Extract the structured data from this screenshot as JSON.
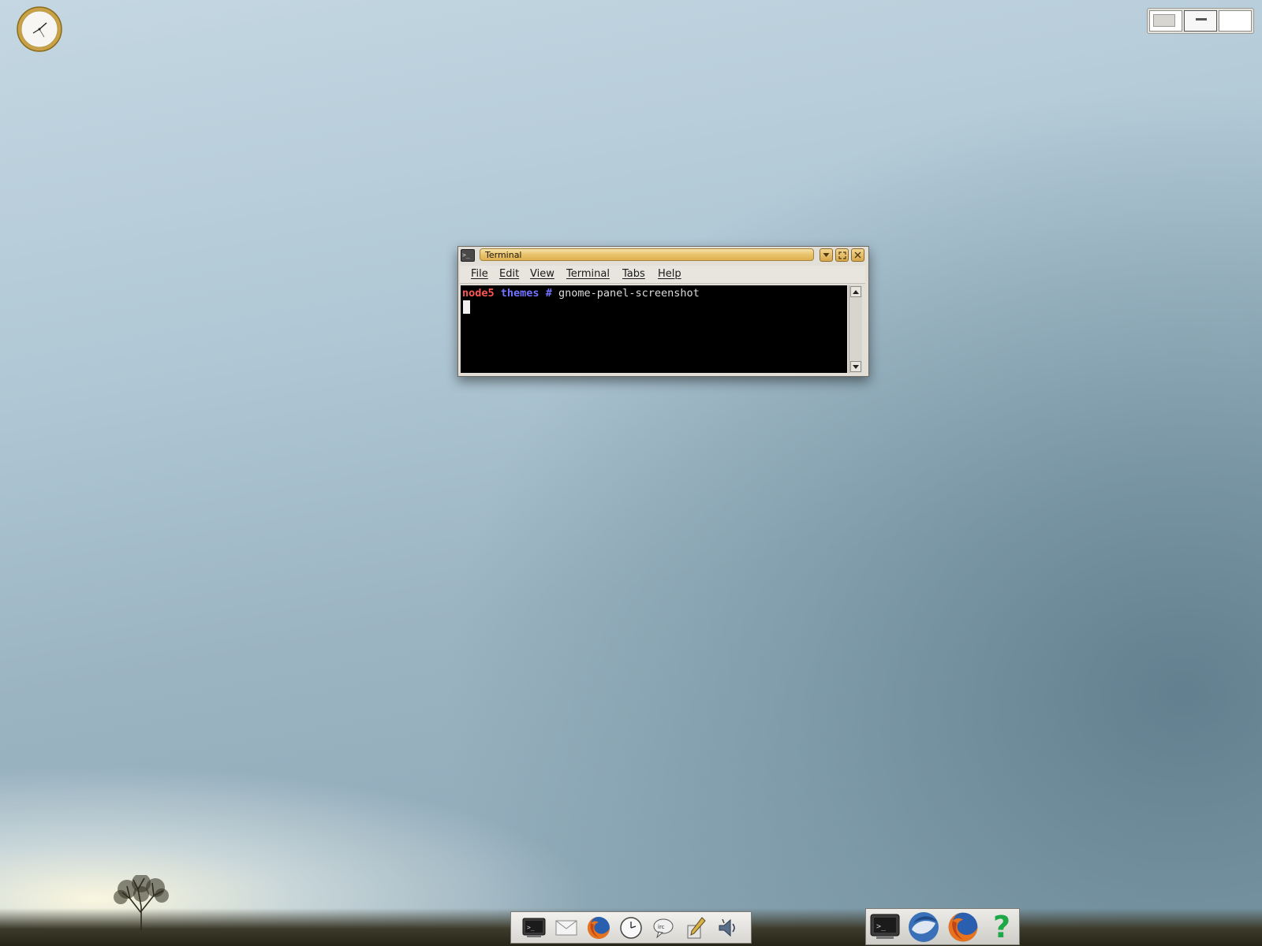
{
  "window": {
    "title": "Terminal",
    "menu": [
      {
        "accel": "F",
        "rest": "ile"
      },
      {
        "accel": "E",
        "rest": "dit"
      },
      {
        "accel": "V",
        "rest": "iew"
      },
      {
        "accel": "T",
        "rest": "erminal"
      },
      {
        "pre": "Ta",
        "accel": "b",
        "rest": "s"
      },
      {
        "accel": "H",
        "rest": "elp"
      }
    ],
    "prompt": {
      "host": "node5",
      "dir": "themes",
      "symbol": "#",
      "command": "gnome-panel-screenshot"
    }
  },
  "dock_left": [
    "terminal-launcher",
    "mail-launcher",
    "firefox-launcher",
    "clock-launcher",
    "irc-launcher",
    "text-editor-launcher",
    "sound-launcher"
  ],
  "dock_right": [
    "terminal-launcher",
    "thunderbird-launcher",
    "firefox-launcher",
    "help-launcher"
  ],
  "help_glyph": "?",
  "colors": {
    "prompt_host": "#ff5555",
    "prompt_dir": "#7272ff",
    "titlebar": "#e9c36c"
  }
}
